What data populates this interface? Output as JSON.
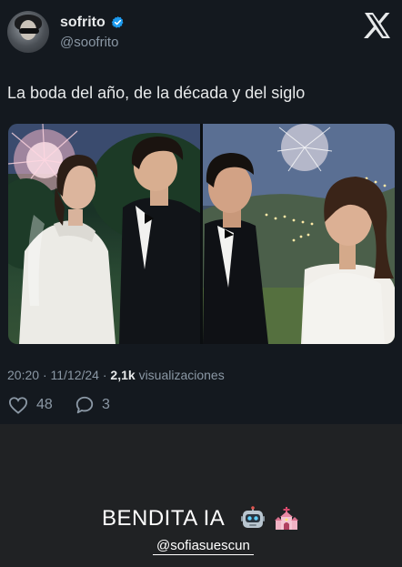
{
  "tweet": {
    "author_name": "sofrito",
    "author_handle": "@soofrito",
    "text": "La boda del año, de la década y del siglo",
    "time": "20:20",
    "date": "11/12/24",
    "views_count": "2,1k",
    "views_label": "visualizaciones",
    "likes": "48",
    "replies": "3"
  },
  "story": {
    "caption": "BENDITA IA",
    "mention": "@sofiasuescun"
  },
  "icons": {
    "verified": "verified-badge-icon",
    "logo": "x-logo-icon",
    "like": "heart-icon",
    "reply": "reply-icon",
    "robot": "robot-emoji",
    "church": "wedding-church-emoji"
  },
  "colors": {
    "background": "#202224",
    "card": "#14191f",
    "verified": "#1d9bf0",
    "muted": "#8b98a5"
  }
}
